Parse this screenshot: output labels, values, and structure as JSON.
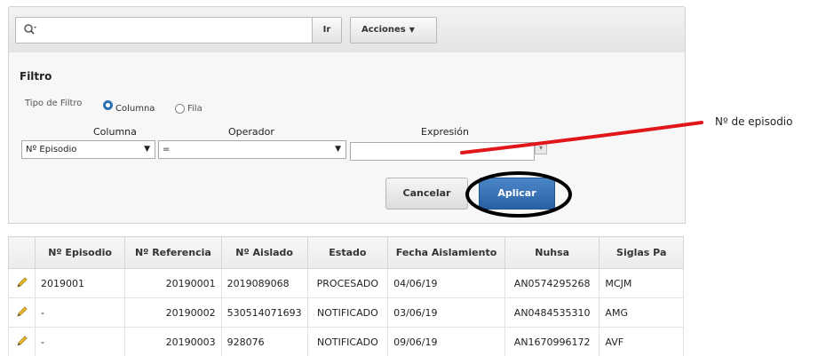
{
  "toolbar": {
    "search_value": "",
    "go_label": "Ir",
    "actions_label": "Acciones"
  },
  "filter": {
    "title": "Filtro",
    "type_label": "Tipo de Filtro",
    "radio_column": "Columna",
    "radio_row": "Fila",
    "selected_type": "Columna",
    "column_header": "Columna",
    "operator_header": "Operador",
    "expression_header": "Expresión",
    "column_value": "Nº Episodio",
    "operator_value": "=",
    "expression_value": "",
    "cancel_label": "Cancelar",
    "apply_label": "Aplicar"
  },
  "annotation": {
    "label": "Nº de episodio",
    "line_color": "#e0161b",
    "circle_color": "#000000"
  },
  "table": {
    "headers": [
      "",
      "Nº Episodio",
      "Nº Referencia",
      "Nº Aislado",
      "Estado",
      "Fecha Aislamiento",
      "Nuhsa",
      "Siglas Pa"
    ],
    "rows": [
      [
        "2019001",
        "20190001",
        "2019089068",
        "PROCESADO",
        "04/06/19",
        "AN0574295268",
        "MCJM"
      ],
      [
        "-",
        "20190002",
        "530514071693",
        "NOTIFICADO",
        "03/06/19",
        "AN0484535310",
        "AMG"
      ],
      [
        "-",
        "20190003",
        "928076",
        "NOTIFICADO",
        "09/06/19",
        "AN1670996172",
        "AVF"
      ]
    ]
  },
  "colors": {
    "primary_button": "#2f6bb0",
    "edit_icon": "#e8b31a"
  }
}
